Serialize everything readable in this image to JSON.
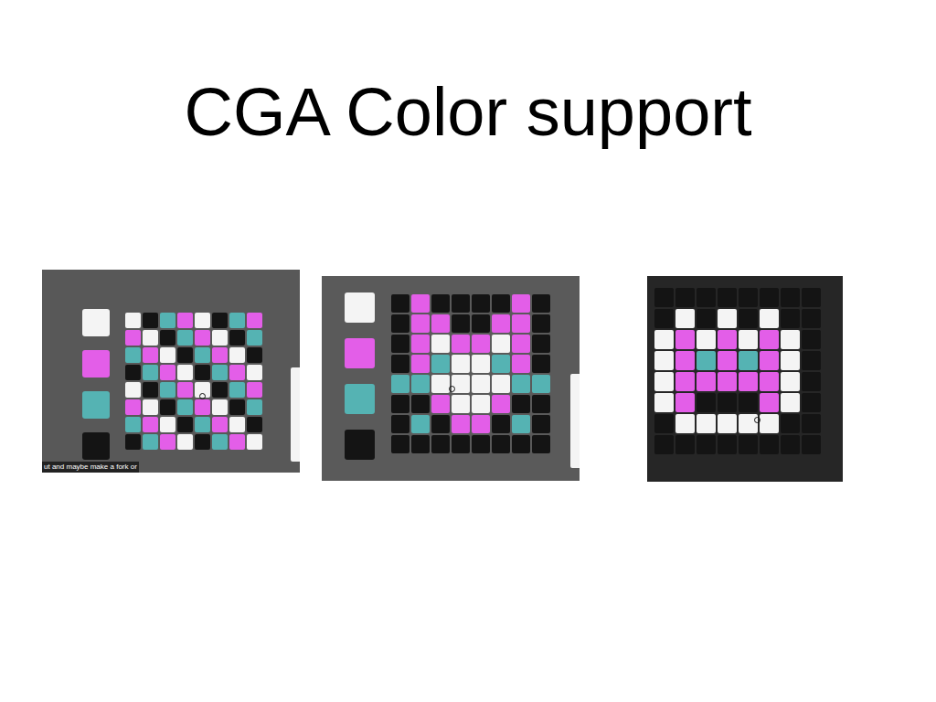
{
  "slide": {
    "title": "CGA Color support"
  },
  "screenshots": [
    {
      "kind": "editor",
      "swatches": [
        {
          "color": "#f4f4f4"
        },
        {
          "color": "#e35ee8"
        },
        {
          "color": "#55b3b3"
        },
        {
          "color": "#141414"
        }
      ],
      "caption": "ut and maybe make a fork or",
      "grid": [
        [
          "#f4f4f4",
          "#141414",
          "#55b3b3",
          "#e35ee8",
          "#f4f4f4",
          "#141414",
          "#55b3b3",
          "#e35ee8"
        ],
        [
          "#e35ee8",
          "#f4f4f4",
          "#141414",
          "#55b3b3",
          "#e35ee8",
          "#f4f4f4",
          "#141414",
          "#55b3b3"
        ],
        [
          "#55b3b3",
          "#e35ee8",
          "#f4f4f4",
          "#141414",
          "#55b3b3",
          "#e35ee8",
          "#f4f4f4",
          "#141414"
        ],
        [
          "#141414",
          "#55b3b3",
          "#e35ee8",
          "#f4f4f4",
          "#141414",
          "#55b3b3",
          "#e35ee8",
          "#f4f4f4"
        ],
        [
          "#f4f4f4",
          "#141414",
          "#55b3b3",
          "#e35ee8",
          "#f4f4f4",
          "#141414",
          "#55b3b3",
          "#e35ee8"
        ],
        [
          "#e35ee8",
          "#f4f4f4",
          "#141414",
          "#55b3b3",
          "#e35ee8",
          "#f4f4f4",
          "#141414",
          "#55b3b3"
        ],
        [
          "#55b3b3",
          "#e35ee8",
          "#f4f4f4",
          "#141414",
          "#55b3b3",
          "#e35ee8",
          "#f4f4f4",
          "#141414"
        ],
        [
          "#141414",
          "#55b3b3",
          "#e35ee8",
          "#f4f4f4",
          "#141414",
          "#55b3b3",
          "#e35ee8",
          "#f4f4f4"
        ]
      ]
    },
    {
      "kind": "editor",
      "swatches": [
        {
          "color": "#f4f4f4"
        },
        {
          "color": "#e35ee8"
        },
        {
          "color": "#55b3b3"
        },
        {
          "color": "#141414"
        }
      ],
      "caption": "",
      "grid": [
        [
          "#141414",
          "#e35ee8",
          "#141414",
          "#141414",
          "#141414",
          "#141414",
          "#e35ee8",
          "#141414"
        ],
        [
          "#141414",
          "#e35ee8",
          "#e35ee8",
          "#141414",
          "#141414",
          "#e35ee8",
          "#e35ee8",
          "#141414"
        ],
        [
          "#141414",
          "#e35ee8",
          "#f4f4f4",
          "#e35ee8",
          "#e35ee8",
          "#f4f4f4",
          "#e35ee8",
          "#141414"
        ],
        [
          "#141414",
          "#e35ee8",
          "#55b3b3",
          "#f4f4f4",
          "#f4f4f4",
          "#55b3b3",
          "#e35ee8",
          "#141414"
        ],
        [
          "#55b3b3",
          "#55b3b3",
          "#f4f4f4",
          "#f4f4f4",
          "#f4f4f4",
          "#f4f4f4",
          "#55b3b3",
          "#55b3b3"
        ],
        [
          "#141414",
          "#141414",
          "#e35ee8",
          "#f4f4f4",
          "#f4f4f4",
          "#e35ee8",
          "#141414",
          "#141414"
        ],
        [
          "#141414",
          "#55b3b3",
          "#141414",
          "#e35ee8",
          "#e35ee8",
          "#141414",
          "#55b3b3",
          "#141414"
        ],
        [
          "#141414",
          "#141414",
          "#141414",
          "#141414",
          "#141414",
          "#141414",
          "#141414",
          "#141414"
        ]
      ]
    },
    {
      "kind": "preview",
      "swatches": [],
      "caption": "",
      "grid": [
        [
          "#141414",
          "#141414",
          "#141414",
          "#141414",
          "#141414",
          "#141414",
          "#141414",
          "#141414"
        ],
        [
          "#141414",
          "#f4f4f4",
          "#141414",
          "#f4f4f4",
          "#141414",
          "#f4f4f4",
          "#141414",
          "#141414"
        ],
        [
          "#f4f4f4",
          "#e35ee8",
          "#f4f4f4",
          "#e35ee8",
          "#f4f4f4",
          "#e35ee8",
          "#f4f4f4",
          "#141414"
        ],
        [
          "#f4f4f4",
          "#e35ee8",
          "#55b3b3",
          "#e35ee8",
          "#55b3b3",
          "#e35ee8",
          "#f4f4f4",
          "#141414"
        ],
        [
          "#f4f4f4",
          "#e35ee8",
          "#e35ee8",
          "#e35ee8",
          "#e35ee8",
          "#e35ee8",
          "#f4f4f4",
          "#141414"
        ],
        [
          "#f4f4f4",
          "#e35ee8",
          "#141414",
          "#141414",
          "#141414",
          "#e35ee8",
          "#f4f4f4",
          "#141414"
        ],
        [
          "#141414",
          "#f4f4f4",
          "#f4f4f4",
          "#f4f4f4",
          "#f4f4f4",
          "#f4f4f4",
          "#141414",
          "#141414"
        ],
        [
          "#141414",
          "#141414",
          "#141414",
          "#141414",
          "#141414",
          "#141414",
          "#141414",
          "#141414"
        ]
      ]
    }
  ]
}
